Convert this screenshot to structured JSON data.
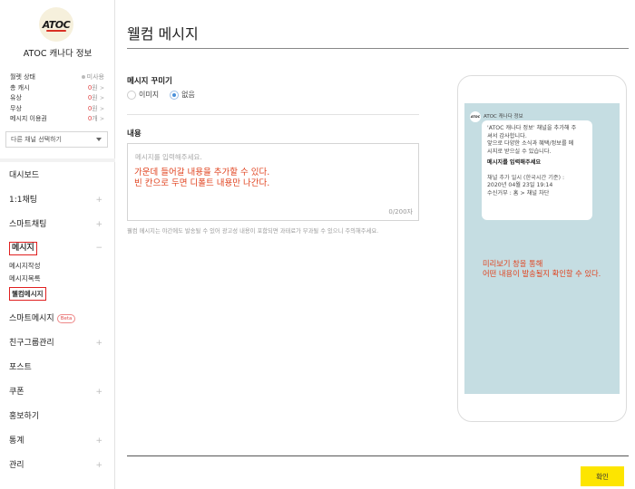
{
  "sidebar": {
    "logo_text": "ATOC",
    "channel_name": "ATOC 캐나다 정보",
    "stats": [
      {
        "label": "월렛 상태",
        "value": "미사용",
        "dot": true
      },
      {
        "label": "총 캐시",
        "num": "0",
        "unit": "원"
      },
      {
        "label": "유상",
        "num": "0",
        "unit": "원"
      },
      {
        "label": "무상",
        "num": "0",
        "unit": "원"
      },
      {
        "label": "메시지 이용권",
        "num": "0",
        "unit": "개"
      }
    ],
    "channel_select": "다른 채널 선택하기",
    "nav": {
      "dashboard": "대시보드",
      "chat": "1:1채팅",
      "smartchat": "스마트채팅",
      "message": "메시지",
      "message_collapse": "−",
      "msg_create": "메시지작성",
      "msg_list": "메시지목록",
      "msg_welcome": "웰컴메시지",
      "smart_message": "스마트메시지",
      "beta": "Beta",
      "friends": "친구그룹관리",
      "post": "포스트",
      "coupon": "쿠폰",
      "promo": "홍보하기",
      "stats": "통계",
      "manage": "관리"
    }
  },
  "main": {
    "title": "웰컴 메시지",
    "decorate_label": "메시지 꾸미기",
    "radio_image": "이미지",
    "radio_none": "없음",
    "content_label": "내용",
    "textarea_placeholder": "메시지를 입력해주세요.",
    "counter": "0/200자",
    "note": "웰컴 메시지는 야간에도 발송될 수 있어 광고성 내용이 포함되면 과태료가 부과될 수 있으니 주의해주세요.",
    "annotation_line1": "가운데 들어갈 내용을 추가할 수 있다.",
    "annotation_line2": "빈 칸으로 두면 디폴트 내용만 나간다.",
    "confirm": "확인"
  },
  "preview": {
    "avatar_text": "ATOC",
    "channel_name": "ATOC 캐나다 정보",
    "line1": "'ATOC 캐나다 정보' 채널을 추가해 주",
    "line2": "셔서 감사합니다.",
    "line3": "앞으로 다양한 소식과 혜택/정보를 메",
    "line4": "시지로 받으실 수 있습니다.",
    "input_prompt": "메시지를 입력해주세요",
    "meta1": "채널 추가 일시 (한국시간 기준) :",
    "meta2": "2020년 04월 23일 19:14",
    "meta3": "수신거부 : 홈 > 채널 차단",
    "note_line1": "미리보기 창을 통해",
    "note_line2": "어떤 내용이 발송될지 확인할 수 있다."
  }
}
